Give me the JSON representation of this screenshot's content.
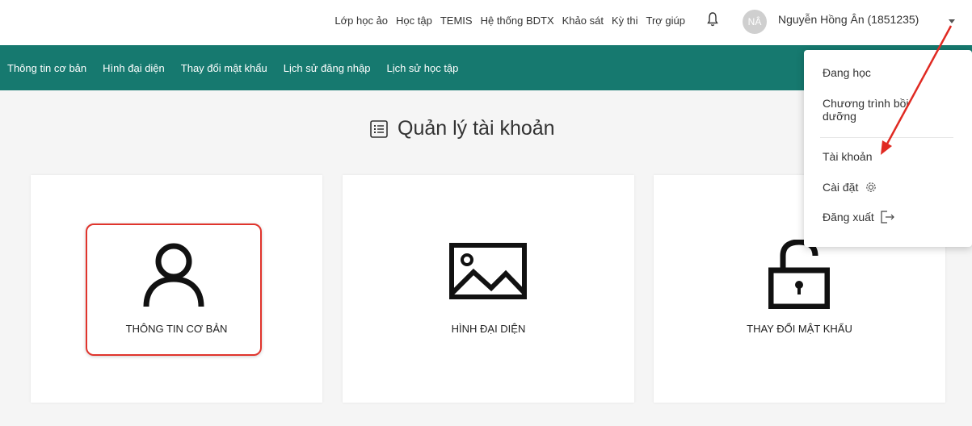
{
  "topnav": {
    "links": [
      "Lớp học ảo",
      "Học tập",
      "TEMIS",
      "Hệ thống BDTX",
      "Khảo sát",
      "Kỳ thi",
      "Trợ giúp"
    ],
    "avatar_initials": "NÂ",
    "username": "Nguyễn Hồng Ân (1851235)"
  },
  "tabs": [
    "Thông tin cơ bản",
    "Hình đại diện",
    "Thay đổi mật khẩu",
    "Lịch sử đăng nhập",
    "Lịch sử học tập"
  ],
  "page_title": "Quản lý tài khoản",
  "cards": [
    {
      "label": "THÔNG TIN CƠ BẢN",
      "icon": "user-icon"
    },
    {
      "label": "HÌNH ĐẠI DIỆN",
      "icon": "image-icon"
    },
    {
      "label": "THAY ĐỔI MẬT KHẨU",
      "icon": "lock-icon"
    }
  ],
  "dropdown": {
    "items": [
      "Đang học",
      "Chương trình bồi dưỡng",
      "Tài khoản",
      "Cài đặt",
      "Đăng xuất"
    ]
  },
  "colors": {
    "green_bar": "#16796f",
    "highlight": "#e0342c",
    "annotation_arrow": "#e02a22"
  }
}
